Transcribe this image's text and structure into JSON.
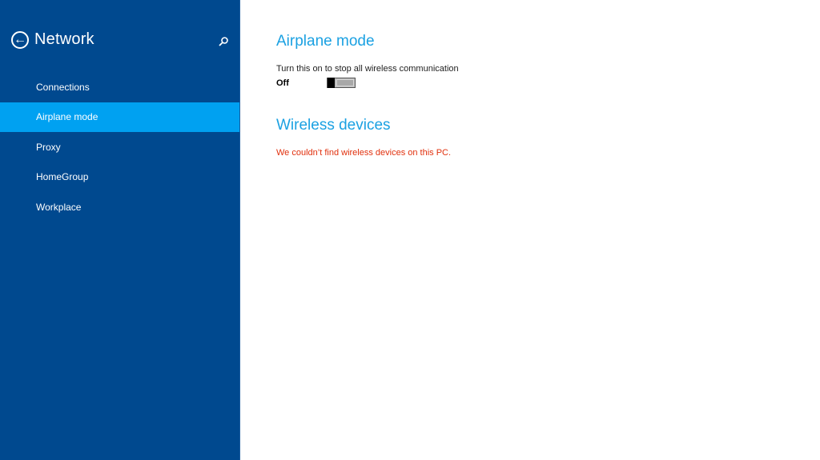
{
  "sidebar": {
    "title": "Network",
    "back_icon": "back-arrow-circle-icon",
    "search_icon": "search-icon",
    "items": [
      {
        "label": "Connections",
        "active": false
      },
      {
        "label": "Airplane mode",
        "active": true
      },
      {
        "label": "Proxy",
        "active": false
      },
      {
        "label": "HomeGroup",
        "active": false
      },
      {
        "label": "Workplace",
        "active": false
      }
    ]
  },
  "main": {
    "airplane": {
      "heading": "Airplane mode",
      "description": "Turn this on to stop all wireless communication",
      "state_label": "Off",
      "toggle_on": false
    },
    "wireless": {
      "heading": "Wireless devices",
      "message": "We couldn’t find wireless devices on this PC."
    }
  },
  "colors": {
    "sidebar_bg": "#00498f",
    "active_item": "#00a1f1",
    "heading": "#1ba1e2",
    "error": "#e1300d"
  }
}
